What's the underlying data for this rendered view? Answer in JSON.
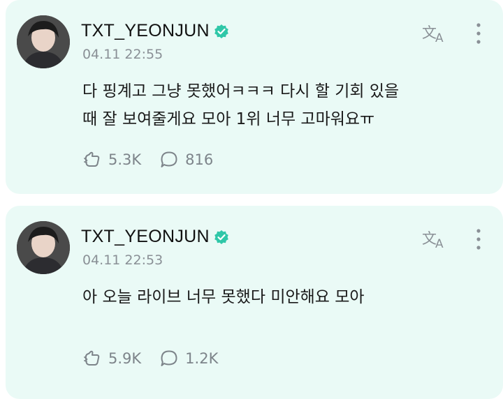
{
  "posts": [
    {
      "username": "TXT_YEONJUN",
      "timestamp": "04.11 22:55",
      "lines": [
        "다 핑계고 그냥 못했어ㅋㅋㅋ 다시 할 기회 있을",
        "때 잘 보여줄게요 모아 1위 너무 고마워요ㅠ"
      ],
      "likes": "5.3K",
      "comments": "816"
    },
    {
      "username": "TXT_YEONJUN",
      "timestamp": "04.11 22:53",
      "lines": [
        "아 오늘 라이브 너무 못했다 미안해요 모아"
      ],
      "likes": "5.9K",
      "comments": "1.2K"
    }
  ],
  "icons": {
    "verified": "verified-badge-icon",
    "translate": "translate-icon",
    "more": "more-vertical-icon",
    "like": "like-hand-icon",
    "comment": "comment-bubble-icon"
  },
  "colors": {
    "card_bg": "#eafaf6",
    "verified": "#2fc7a8",
    "muted": "#8a9096"
  }
}
